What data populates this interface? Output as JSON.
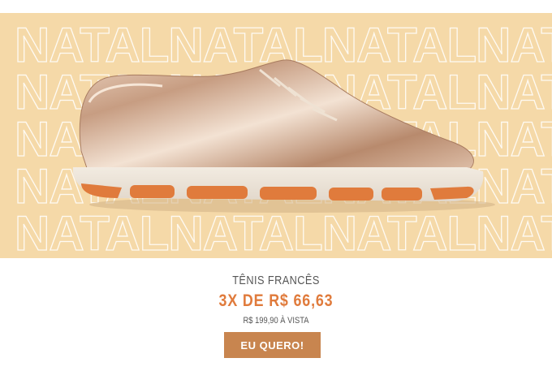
{
  "banner": {
    "bg_word": "NATAL",
    "bg_color": "#f5d9a8",
    "image_alt": "shoe-image"
  },
  "product": {
    "name": "TÊNIS FRANCÊS",
    "installments": "3X DE R$ 66,63",
    "cash_price": "R$ 199,90 À VISTA",
    "accent_color": "#e07b3c"
  },
  "cta": {
    "label": "EU QUERO!",
    "color": "#c8854f"
  }
}
